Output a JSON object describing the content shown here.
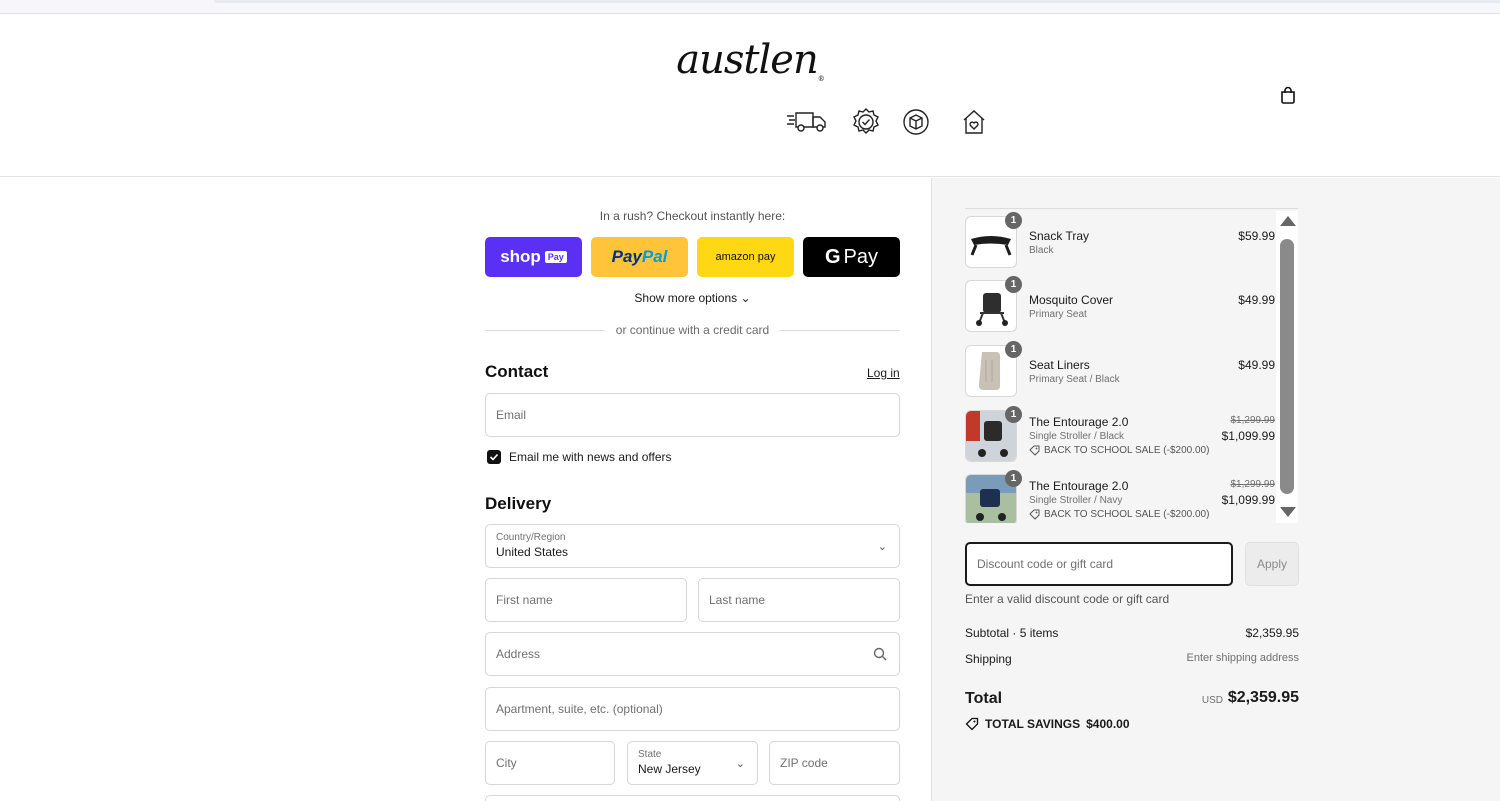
{
  "brand": {
    "logo_text": "austlen",
    "logo_mark": "®"
  },
  "header": {
    "trust_icons": [
      "fast-shipping-truck-icon",
      "verified-badge-icon",
      "warranty-box-icon",
      "home-heart-icon"
    ],
    "cart_icon": "shopping-bag-icon"
  },
  "express": {
    "prompt": "In a rush? Checkout instantly here:",
    "shop_label": "shop",
    "shop_badge": "Pay",
    "paypal_a": "Pay",
    "paypal_b": "Pal",
    "amazon_label": "amazon pay",
    "gpay_g": "G",
    "gpay_label": "Pay",
    "more_options": "Show more options",
    "divider_text": "or continue with a credit card"
  },
  "contact": {
    "title": "Contact",
    "login": "Log in",
    "email_placeholder": "Email",
    "newsletter_label": "Email me with news and offers",
    "newsletter_checked": true
  },
  "delivery": {
    "title": "Delivery",
    "country_label": "Country/Region",
    "country_value": "United States",
    "first_name_placeholder": "First name",
    "last_name_placeholder": "Last name",
    "address_placeholder": "Address",
    "apartment_placeholder": "Apartment, suite, etc. (optional)",
    "city_placeholder": "City",
    "state_label": "State",
    "state_value": "New Jersey",
    "zip_placeholder": "ZIP code"
  },
  "cart": {
    "items": [
      {
        "qty": "1",
        "name": "Snack Tray",
        "variant": "Black",
        "price": "$59.99"
      },
      {
        "qty": "1",
        "name": "Mosquito Cover",
        "variant": "Primary Seat",
        "price": "$49.99"
      },
      {
        "qty": "1",
        "name": "Seat Liners",
        "variant": "Primary Seat / Black",
        "price": "$49.99"
      },
      {
        "qty": "1",
        "name": "The Entourage 2.0",
        "variant": "Single Stroller / Black",
        "discount": "BACK TO SCHOOL SALE (-$200.00)",
        "old_price": "$1,299.99",
        "price": "$1,099.99"
      },
      {
        "qty": "1",
        "name": "The Entourage 2.0",
        "variant": "Single Stroller / Navy",
        "discount": "BACK TO SCHOOL SALE (-$200.00)",
        "old_price": "$1,299.99",
        "price": "$1,099.99"
      }
    ]
  },
  "discount": {
    "placeholder": "Discount code or gift card",
    "apply": "Apply",
    "hint": "Enter a valid discount code or gift card"
  },
  "summary": {
    "subtotal_label": "Subtotal · 5 items",
    "subtotal_value": "$2,359.95",
    "shipping_label": "Shipping",
    "shipping_value": "Enter shipping address",
    "total_label": "Total",
    "currency": "USD",
    "total_value": "$2,359.95",
    "savings_label": "TOTAL SAVINGS",
    "savings_value": "$400.00"
  },
  "colors": {
    "shop_pay": "#5a31f4",
    "paypal": "#ffc439",
    "amazon_pay": "#ffd814",
    "gpay": "#000000",
    "summary_bg": "#f5f5f5"
  }
}
